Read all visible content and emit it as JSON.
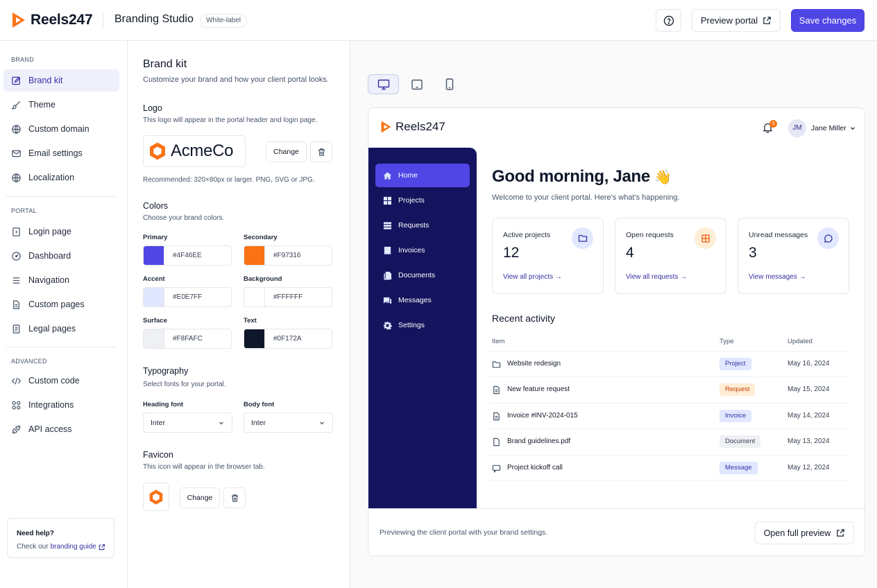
{
  "app": {
    "name": "Reels247",
    "section": "Branding Studio",
    "badge": "White-label"
  },
  "header": {
    "help_icon": "help-circle-icon",
    "preview_label": "Preview portal",
    "save_label": "Save changes",
    "accent": "#4f46e5",
    "brand_orange": "#f97316"
  },
  "sidebar": {
    "groups": [
      {
        "title": "BRAND",
        "items": [
          {
            "label": "Brand kit",
            "icon": "edit-square-icon",
            "active": true
          },
          {
            "label": "Theme",
            "icon": "brush-icon"
          },
          {
            "label": "Custom domain",
            "icon": "globe-icon"
          },
          {
            "label": "Email settings",
            "icon": "mail-icon"
          },
          {
            "label": "Localization",
            "icon": "globe-icon"
          }
        ]
      },
      {
        "title": "PORTAL",
        "items": [
          {
            "label": "Login page",
            "icon": "login-icon"
          },
          {
            "label": "Dashboard",
            "icon": "dashboard-icon"
          },
          {
            "label": "Navigation",
            "icon": "menu-lines-icon"
          },
          {
            "label": "Custom pages",
            "icon": "page-icon"
          },
          {
            "label": "Legal pages",
            "icon": "document-icon"
          }
        ]
      },
      {
        "title": "ADVANCED",
        "items": [
          {
            "label": "Custom code",
            "icon": "code-icon"
          },
          {
            "label": "Integrations",
            "icon": "integrations-icon"
          },
          {
            "label": "API access",
            "icon": "api-icon"
          }
        ]
      }
    ],
    "help": {
      "title": "Need help?",
      "prefix": "Check our",
      "link": "branding guide"
    }
  },
  "brand_kit": {
    "title": "Brand kit",
    "subtitle": "Customize your brand and how your client portal looks.",
    "logo": {
      "title": "Logo",
      "desc": "This logo will appear in the portal header and login page.",
      "name": "AcmeCo",
      "change": "Change",
      "hint": "Recommended: 320×80px or larger. PNG, SVG or JPG."
    },
    "colors": {
      "title": "Colors",
      "desc": "Choose your brand colors.",
      "items": [
        {
          "label": "Primary",
          "value": "#4F46EE"
        },
        {
          "label": "Secondary",
          "value": "#F97316"
        },
        {
          "label": "Accent",
          "value": "#E0E7FF"
        },
        {
          "label": "Background",
          "value": "#FFFFFF"
        },
        {
          "label": "Surface",
          "value": "#F8FAFC"
        },
        {
          "label": "Text",
          "value": "#0F172A"
        }
      ]
    },
    "typography": {
      "title": "Typography",
      "desc": "Select fonts for your portal.",
      "heading_label": "Heading font",
      "heading_value": "Inter",
      "body_label": "Body font",
      "body_value": "Inter"
    },
    "favicon": {
      "title": "Favicon",
      "desc": "This icon will appear in the browser tab.",
      "change": "Change"
    }
  },
  "preview": {
    "devices": [
      "desktop-icon",
      "tablet-icon",
      "mobile-icon"
    ],
    "portal_name": "Reels247",
    "notifications": "3",
    "user": {
      "initials": "JM",
      "name": "Jane Miller"
    },
    "nav": [
      {
        "label": "Home",
        "icon": "home-icon",
        "active": true
      },
      {
        "label": "Projects",
        "icon": "grid-icon"
      },
      {
        "label": "Requests",
        "icon": "list-icon"
      },
      {
        "label": "Invoices",
        "icon": "invoice-icon"
      },
      {
        "label": "Documents",
        "icon": "documents-icon"
      },
      {
        "label": "Messages",
        "icon": "chat-icon"
      },
      {
        "label": "Settings",
        "icon": "gear-icon"
      }
    ],
    "greeting": "Good morning, Jane",
    "welcome": "Welcome to your client portal. Here's what's happening.",
    "cards": [
      {
        "title": "Active projects",
        "value": "12",
        "link": "View all projects →",
        "icon": "folder-icon",
        "icon_bg": "#e0e7ff",
        "icon_color": "#3730a3"
      },
      {
        "title": "Open requests",
        "value": "4",
        "link": "View all requests →",
        "icon": "request-grid-icon",
        "icon_bg": "#ffedd5",
        "icon_color": "#ea580c"
      },
      {
        "title": "Unread messages",
        "value": "3",
        "link": "View messages →",
        "icon": "message-icon",
        "icon_bg": "#e0e7ff",
        "icon_color": "#3730a3"
      }
    ],
    "recent": {
      "title": "Recent activity",
      "columns": [
        "Item",
        "Type",
        "Updated"
      ],
      "rows": [
        {
          "item": "Website redesign",
          "type": "Project",
          "updated": "May 16, 2024",
          "icon": "folder-icon",
          "bg": "#e0e7ff",
          "fg": "#3730a3"
        },
        {
          "item": "New feature request",
          "type": "Request",
          "updated": "May 15, 2024",
          "icon": "file-icon",
          "bg": "#ffedd5",
          "fg": "#c2410c"
        },
        {
          "item": "Invoice #INV-2024-015",
          "type": "Invoice",
          "updated": "May 14, 2024",
          "icon": "file-icon",
          "bg": "#e0e7ff",
          "fg": "#3730a3"
        },
        {
          "item": "Brand guidelines.pdf",
          "type": "Document",
          "updated": "May 13, 2024",
          "icon": "file-icon",
          "bg": "#eef0f3",
          "fg": "#374151"
        },
        {
          "item": "Project kickoff call",
          "type": "Message",
          "updated": "May 12, 2024",
          "icon": "message-icon",
          "bg": "#e0e7ff",
          "fg": "#3730a3"
        }
      ]
    },
    "footer": {
      "text": "Previewing the client portal with your brand settings.",
      "open_label": "Open full preview"
    }
  }
}
